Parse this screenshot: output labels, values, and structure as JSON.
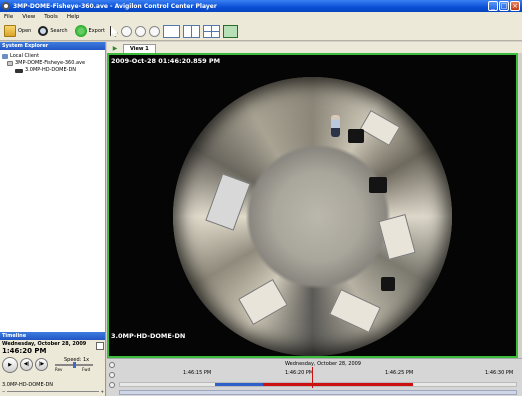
{
  "window": {
    "title": "3MP-DOME-Fisheye-360.ave - Avigilon Control Center Player"
  },
  "menu": [
    "File",
    "View",
    "Tools",
    "Help"
  ],
  "toolbar": {
    "open_label": "Open",
    "search_label": "Search",
    "export_label": "Export"
  },
  "system_explorer": {
    "title": "System Explorer",
    "items": [
      "Local Client",
      "3MP-DOME-Fisheye-360.ave",
      "3.0MP-HD-DOME-DN"
    ]
  },
  "view_tab": {
    "label": "View 1"
  },
  "video": {
    "timestamp": "2009-Oct-28 01:46:20.859 PM",
    "camera_label": "3.0MP-HD-DOME-DN"
  },
  "timeline": {
    "title": "Timeline",
    "date": "Wednesday, October 28, 2009",
    "time": "1:46:20 PM",
    "speed_label": "Speed: 1x",
    "speed_rev": "Rev",
    "speed_fwd": "Fwd",
    "speed_fraction": 0.5,
    "camera": "3.0MP-HD-DOME-DN"
  },
  "scrubber": {
    "date": "Wednesday, October 28, 2009",
    "ticks": [
      "1:46:15 PM",
      "1:46:20 PM",
      "1:46:25 PM",
      "1:46:30 PM"
    ]
  },
  "colors": {
    "active_border": "#3cbc3c",
    "recording": "#cc1111",
    "motion": "#2f5fc8"
  }
}
